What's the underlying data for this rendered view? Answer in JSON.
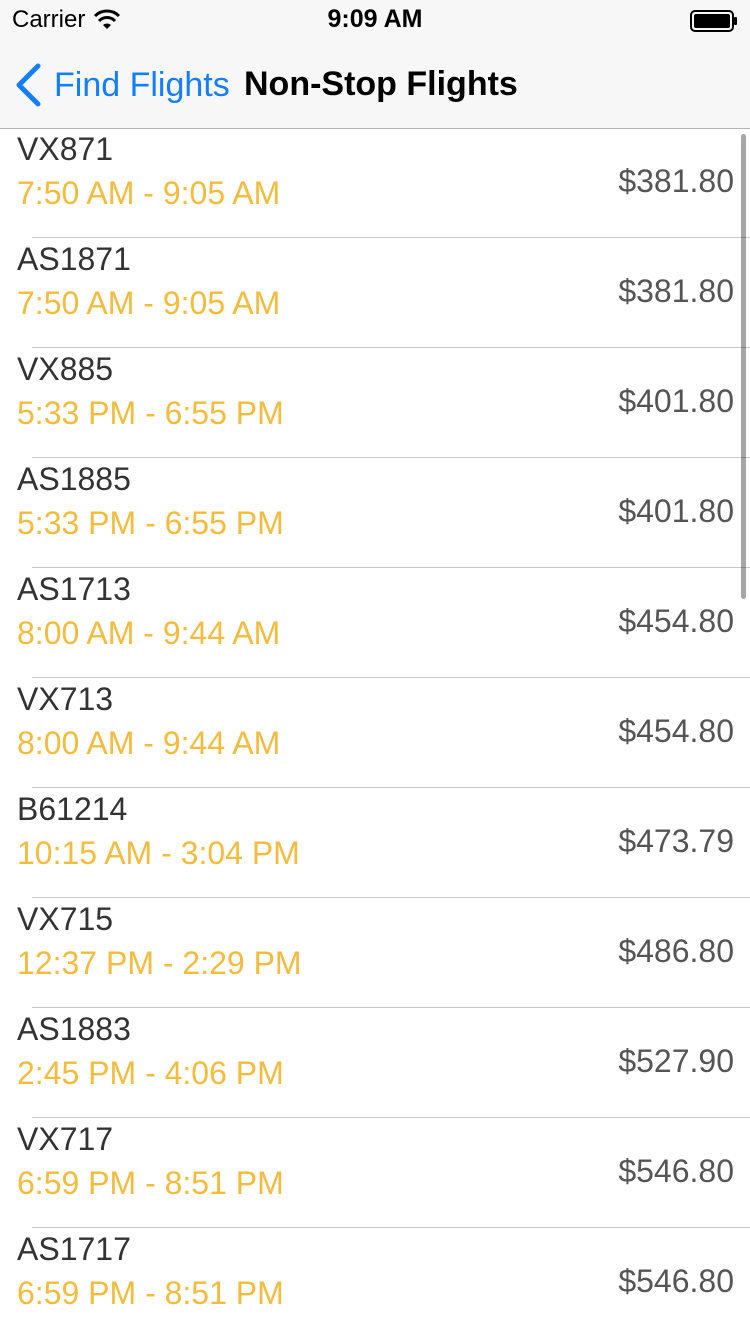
{
  "status_bar": {
    "carrier": "Carrier",
    "time": "9:09 AM",
    "wifi_icon": "wifi-icon",
    "battery_icon": "battery-icon"
  },
  "nav": {
    "back_label": "Find Flights",
    "back_icon": "chevron-left-icon",
    "title": "Non-Stop Flights",
    "accent_color": "#157efb"
  },
  "colors": {
    "time_text": "#f4bb3c",
    "flight_text": "#333333",
    "price_text": "#555555"
  },
  "flights": [
    {
      "number": "VX871",
      "times": "7:50 AM - 9:05 AM",
      "price": "$381.80"
    },
    {
      "number": "AS1871",
      "times": "7:50 AM - 9:05 AM",
      "price": "$381.80"
    },
    {
      "number": "VX885",
      "times": "5:33 PM - 6:55 PM",
      "price": "$401.80"
    },
    {
      "number": "AS1885",
      "times": "5:33 PM - 6:55 PM",
      "price": "$401.80"
    },
    {
      "number": "AS1713",
      "times": "8:00 AM - 9:44 AM",
      "price": "$454.80"
    },
    {
      "number": "VX713",
      "times": "8:00 AM - 9:44 AM",
      "price": "$454.80"
    },
    {
      "number": "B61214",
      "times": "10:15 AM - 3:04 PM",
      "price": "$473.79"
    },
    {
      "number": "VX715",
      "times": "12:37 PM - 2:29 PM",
      "price": "$486.80"
    },
    {
      "number": "AS1883",
      "times": "2:45 PM - 4:06 PM",
      "price": "$527.90"
    },
    {
      "number": "VX717",
      "times": "6:59 PM - 8:51 PM",
      "price": "$546.80"
    },
    {
      "number": "AS1717",
      "times": "6:59 PM - 8:51 PM",
      "price": "$546.80"
    }
  ]
}
